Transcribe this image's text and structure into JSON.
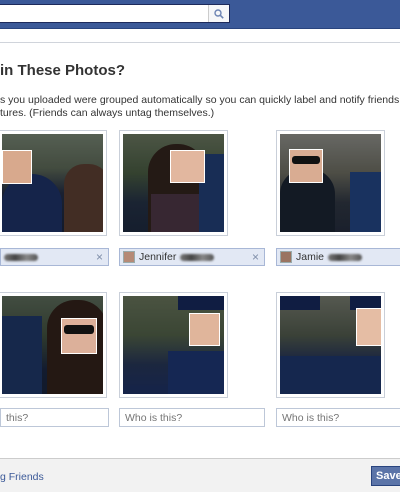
{
  "topbar": {
    "search_placeholder": "",
    "search_icon": "magnifier-icon",
    "brand_color": "#3b5998"
  },
  "dialog": {
    "title": "in These Photos?",
    "description_line1": "s you uploaded were grouped automatically so you can quickly label and notify friends in",
    "description_line2": "tures. (Friends can always untag themselves.)"
  },
  "row1": [
    {
      "tag_name": "",
      "remove": "×"
    },
    {
      "tag_name": "Jennifer",
      "remove": "×"
    },
    {
      "tag_name": "Jamie",
      "remove": ""
    }
  ],
  "row2": [
    {
      "placeholder": "this?"
    },
    {
      "placeholder": "Who is this?"
    },
    {
      "placeholder": "Who is this?"
    }
  ],
  "footer": {
    "link": "g Friends",
    "save_label": "Save"
  }
}
